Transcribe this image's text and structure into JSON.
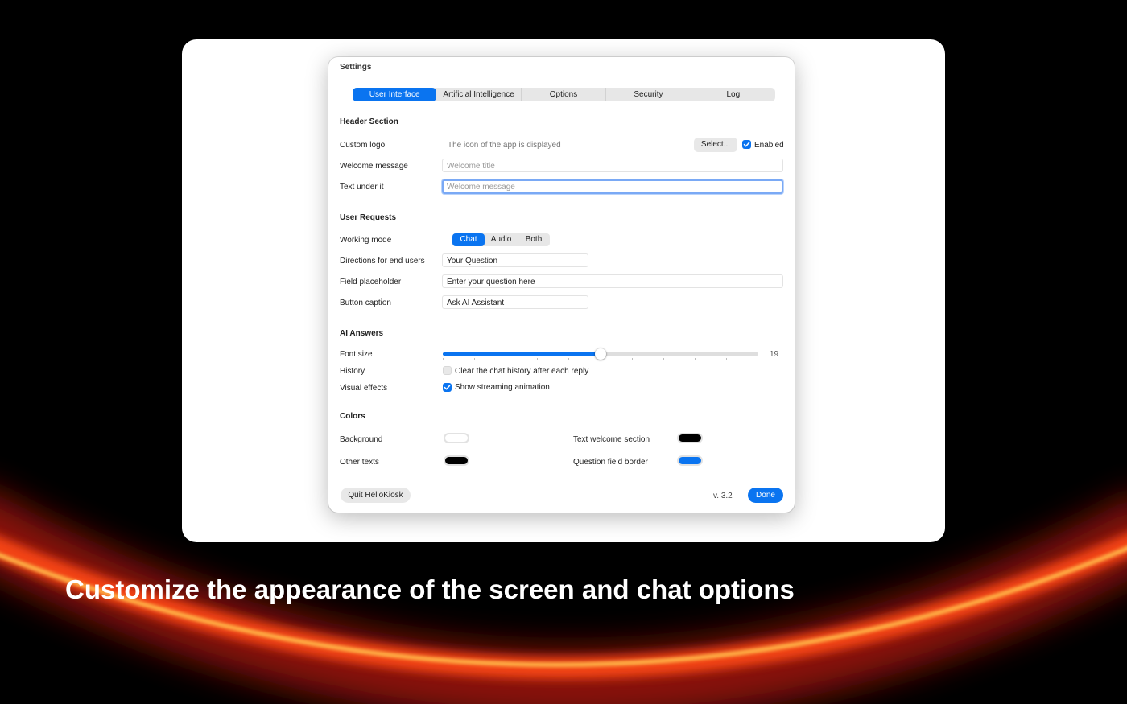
{
  "window": {
    "title": "Settings",
    "tabs": [
      {
        "label": "User Interface",
        "active": true
      },
      {
        "label": "Artificial Intelligence",
        "active": false
      },
      {
        "label": "Options",
        "active": false
      },
      {
        "label": "Security",
        "active": false
      },
      {
        "label": "Log",
        "active": false
      }
    ]
  },
  "header_section": {
    "title": "Header Section",
    "custom_logo": {
      "label": "Custom logo",
      "hint": "The icon of the app is displayed",
      "select_label": "Select...",
      "enabled_label": "Enabled",
      "enabled": true
    },
    "welcome_message": {
      "label": "Welcome message",
      "placeholder": "Welcome title"
    },
    "text_under": {
      "label": "Text under it",
      "placeholder": "Welcome message"
    }
  },
  "user_requests": {
    "title": "User Requests",
    "working_mode": {
      "label": "Working mode",
      "options": [
        "Chat",
        "Audio",
        "Both"
      ],
      "selected": "Chat"
    },
    "directions": {
      "label": "Directions for end users",
      "value": "Your Question"
    },
    "field_placeholder": {
      "label": "Field placeholder",
      "value": "Enter your question here"
    },
    "button_caption": {
      "label": "Button caption",
      "value": "Ask AI Assistant"
    }
  },
  "ai_answers": {
    "title": "AI Answers",
    "font_size": {
      "label": "Font size",
      "value": "19",
      "fraction": 0.5
    },
    "history": {
      "label": "History",
      "option": "Clear the chat history after each reply",
      "checked": false
    },
    "visual_effects": {
      "label": "Visual effects",
      "option": "Show streaming animation",
      "checked": true
    }
  },
  "colors": {
    "title": "Colors",
    "background": {
      "label": "Background",
      "color": "#ffffff"
    },
    "other_texts": {
      "label": "Other texts",
      "color": "#000000"
    },
    "text_welcome": {
      "label": "Text welcome section",
      "color": "#000000"
    },
    "question_border": {
      "label": "Question field border",
      "color": "#0a74f0"
    }
  },
  "footer": {
    "quit_label": "Quit HelloKiosk",
    "version": "v. 3.2",
    "done_label": "Done"
  },
  "caption": "Customize the appearance of the screen and chat options",
  "theme": {
    "accent": "#0a74f0",
    "glow": "#ff6a1a"
  }
}
